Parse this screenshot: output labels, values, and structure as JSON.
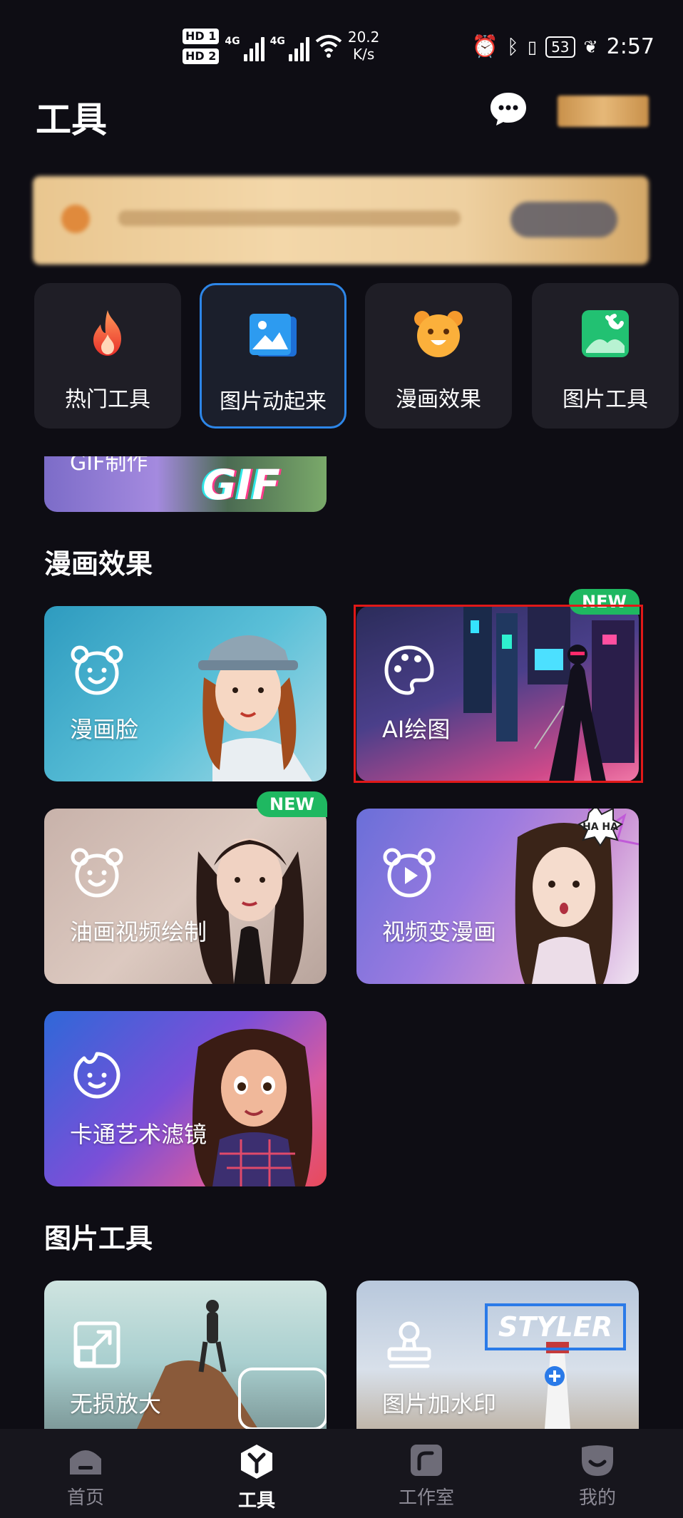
{
  "status_bar": {
    "sim1": "HD 1",
    "sim2": "HD 2",
    "net1": "4G",
    "net2": "4G",
    "speed_value": "20.2",
    "speed_unit": "K/s",
    "battery": "53",
    "time": "2:57"
  },
  "header": {
    "title": "工具"
  },
  "categories": [
    {
      "label": "热门工具",
      "icon": "flame-icon"
    },
    {
      "label": "图片动起来",
      "icon": "image-stack-icon",
      "active": true
    },
    {
      "label": "漫画效果",
      "icon": "bear-face-icon"
    },
    {
      "label": "图片工具",
      "icon": "image-wrench-icon"
    }
  ],
  "partial_card": {
    "label": "GIF制作",
    "art_text": "GIF"
  },
  "sections": {
    "comic": {
      "title": "漫画效果",
      "cards": [
        {
          "label": "漫画脸",
          "icon": "bear-face-icon",
          "new": false
        },
        {
          "label": "AI绘图",
          "icon": "palette-icon",
          "new": true
        },
        {
          "label": "油画视频绘制",
          "icon": "bear-face-icon",
          "new": true
        },
        {
          "label": "视频变漫画",
          "icon": "bear-play-icon",
          "new": false,
          "art_text": "HA HA"
        },
        {
          "label": "卡通艺术滤镜",
          "icon": "smile-icon",
          "new": false
        }
      ]
    },
    "image_tools": {
      "title": "图片工具",
      "cards": [
        {
          "label": "无损放大",
          "icon": "expand-icon"
        },
        {
          "label": "图片加水印",
          "icon": "stamp-icon",
          "art_text": "STYLER"
        }
      ]
    }
  },
  "badge_new": "NEW",
  "bottom_nav": [
    {
      "label": "首页",
      "icon": "home-icon"
    },
    {
      "label": "工具",
      "icon": "tools-icon",
      "active": true
    },
    {
      "label": "工作室",
      "icon": "studio-icon"
    },
    {
      "label": "我的",
      "icon": "profile-icon"
    }
  ],
  "colors": {
    "accent": "#2d86e8",
    "new_badge": "#1fb861",
    "background": "#0e0d14"
  }
}
